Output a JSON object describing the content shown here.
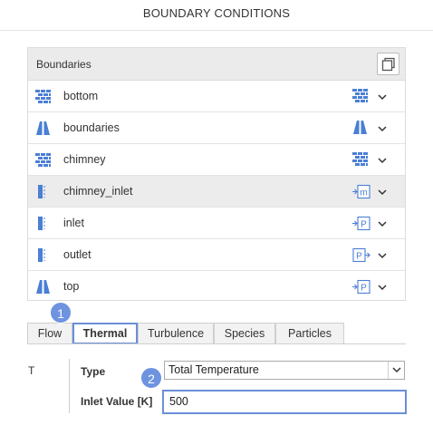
{
  "title": "BOUNDARY CONDITIONS",
  "boundaries": {
    "header": "Boundaries",
    "items": [
      {
        "name": "bottom",
        "lead_icon": "wall-icon",
        "right_icon": "wall-icon",
        "right_letter": ""
      },
      {
        "name": "boundaries",
        "lead_icon": "symmetry-icon",
        "right_icon": "symmetry-icon",
        "right_letter": ""
      },
      {
        "name": "chimney",
        "lead_icon": "wall-icon",
        "right_icon": "wall-icon",
        "right_letter": ""
      },
      {
        "name": "chimney_inlet",
        "lead_icon": "patch-icon",
        "right_icon": "mass-flow-inlet-icon",
        "right_letter": "m"
      },
      {
        "name": "inlet",
        "lead_icon": "patch-icon",
        "right_icon": "pressure-inlet-icon",
        "right_letter": "P"
      },
      {
        "name": "outlet",
        "lead_icon": "patch-icon",
        "right_icon": "pressure-outlet-icon",
        "right_letter": "P"
      },
      {
        "name": "top",
        "lead_icon": "symmetry-icon",
        "right_icon": "pressure-inlet-icon",
        "right_letter": "P"
      }
    ]
  },
  "tabs": [
    "Flow",
    "Thermal",
    "Turbulence",
    "Species",
    "Particles"
  ],
  "active_tab": "Thermal",
  "badges": [
    "1",
    "2"
  ],
  "thermal": {
    "section": "T",
    "type_label": "Type",
    "type_value": "Total Temperature",
    "inlet_label": "Inlet Value [K]",
    "inlet_value": "500"
  },
  "colors": {
    "accent": "#6b8fd8",
    "icon_blue": "#4a7fd4",
    "badge": "#6e93df",
    "selected_row": "#ececec"
  }
}
